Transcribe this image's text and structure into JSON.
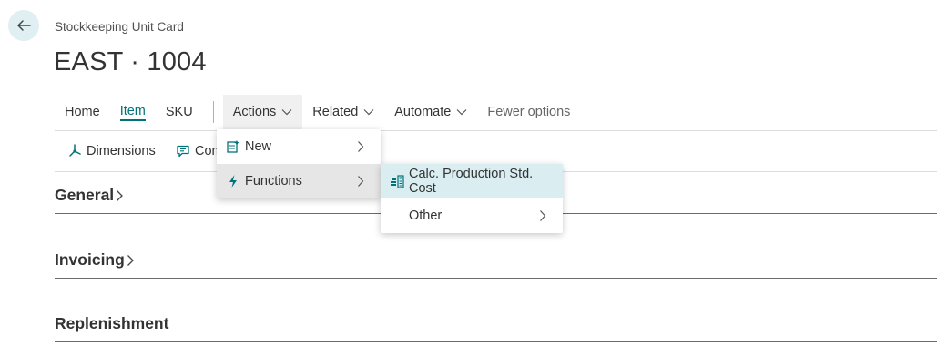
{
  "page": {
    "caption": "Stockkeeping Unit Card",
    "title": "EAST · 1004"
  },
  "nav": {
    "tabs": [
      "Home",
      "Item",
      "SKU"
    ],
    "menus": [
      "Actions",
      "Related",
      "Automate"
    ],
    "fewer_options": "Fewer options"
  },
  "toolbar": {
    "dimensions": "Dimensions",
    "comments": "Comments"
  },
  "actions_menu": {
    "new": "New",
    "functions": "Functions"
  },
  "functions_submenu": {
    "calc": "Calc. Production Std. Cost",
    "other": "Other"
  },
  "sections": [
    "General",
    "Invoicing",
    "Replenishment"
  ],
  "colors": {
    "accent": "#00737a",
    "back_button_bg": "#dfeff2",
    "submenu_hover": "#daeef1"
  },
  "icons": [
    "back-arrow-icon",
    "dimensions-icon",
    "comment-icon",
    "new-document-icon",
    "lightning-icon",
    "calculator-icon",
    "chevron-right-icon",
    "chevron-down-icon"
  ]
}
